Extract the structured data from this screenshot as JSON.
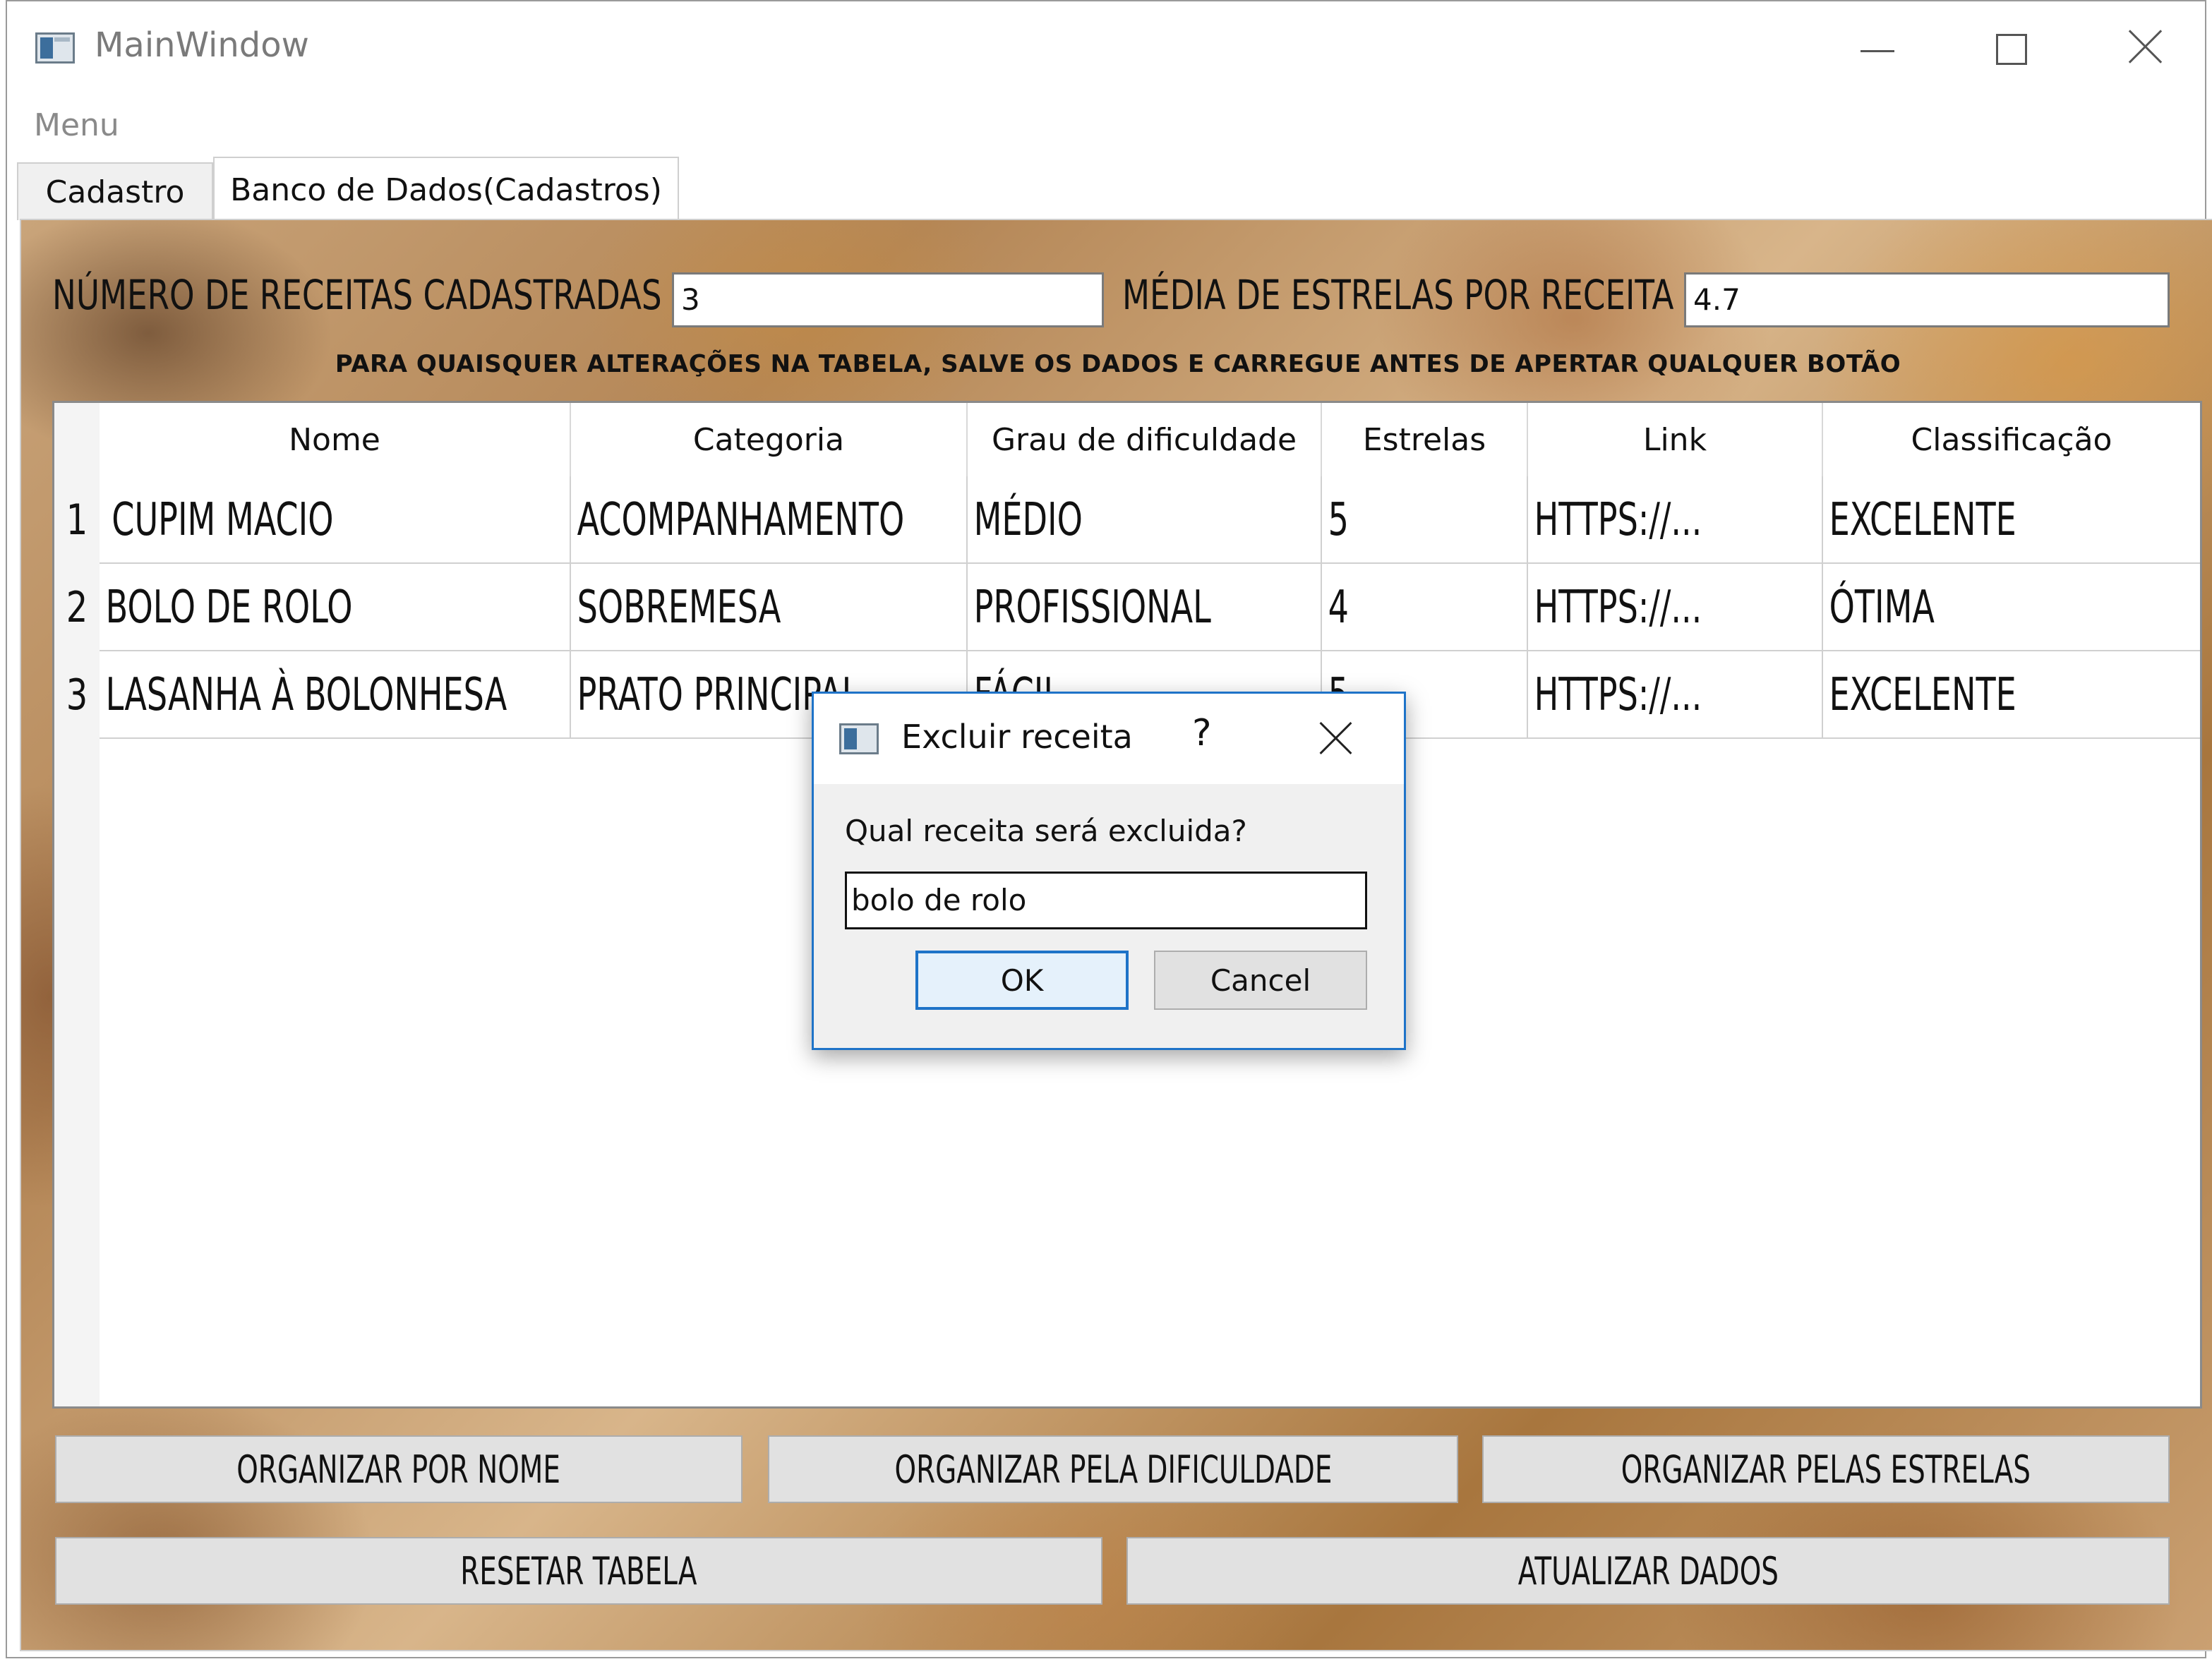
{
  "window": {
    "title": "MainWindow"
  },
  "menubar": {
    "menu_label": "Menu"
  },
  "tabs": [
    {
      "label": "Cadastro"
    },
    {
      "label": "Banco de Dados(Cadastros)"
    }
  ],
  "stats": {
    "num_label": "NÚMERO DE RECEITAS CADASTRADAS",
    "num_value": "3",
    "media_label": "MÉDIA DE ESTRELAS POR RECEITA",
    "media_value": "4.7"
  },
  "notice": "PARA QUAISQUER ALTERAÇÕES NA TABELA, SALVE OS DADOS E CARREGUE ANTES DE APERTAR QUALQUER BOTÃO",
  "table": {
    "headers": [
      "Nome",
      "Categoria",
      "Grau de dificuldade",
      "Estrelas",
      "Link",
      "Classificação"
    ],
    "rows": [
      {
        "num": "1",
        "cells": [
          "CUPIM MACIO",
          "ACOMPANHAMENTO",
          "MÉDIO",
          "5",
          "HTTPS://...",
          "EXCELENTE"
        ]
      },
      {
        "num": "2",
        "cells": [
          "BOLO DE ROLO",
          "SOBREMESA",
          "PROFISSIONAL",
          "4",
          "HTTPS://...",
          "ÓTIMA"
        ]
      },
      {
        "num": "3",
        "cells": [
          "LASANHA À BOLONHESA",
          "PRATO PRINCIPAL",
          "FÁCIL",
          "5",
          "HTTPS://...",
          "EXCELENTE"
        ]
      }
    ]
  },
  "buttons": {
    "org_nome": "ORGANIZAR POR NOME",
    "org_dificuldade": "ORGANIZAR PELA DIFICULDADE",
    "org_estrelas": "ORGANIZAR PELAS ESTRELAS",
    "resetar": "RESETAR TABELA",
    "atualizar": "ATUALIZAR DADOS"
  },
  "dialog": {
    "title": "Excluir receita",
    "help": "?",
    "question": "Qual receita será excluida?",
    "input_value": "bolo de rolo",
    "ok": "OK",
    "cancel": "Cancel"
  }
}
